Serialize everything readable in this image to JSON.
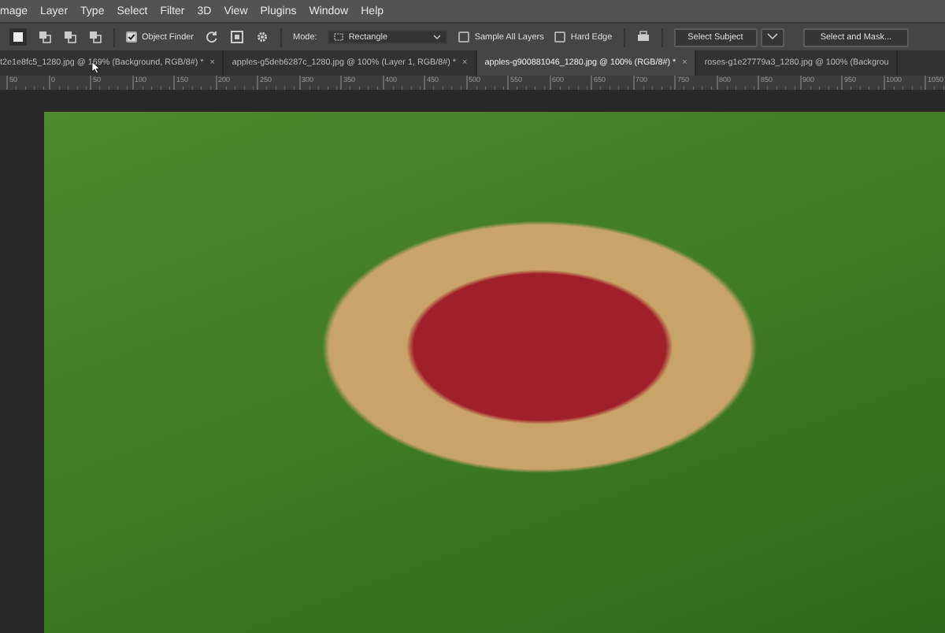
{
  "menu": [
    "mage",
    "Layer",
    "Type",
    "Select",
    "Filter",
    "3D",
    "View",
    "Plugins",
    "Window",
    "Help"
  ],
  "options": {
    "object_finder": {
      "label": "Object Finder",
      "checked": true
    },
    "mode_label": "Mode:",
    "mode_value": "Rectangle",
    "sample_all_layers": {
      "label": "Sample All Layers",
      "checked": false
    },
    "hard_edge": {
      "label": "Hard Edge",
      "checked": false
    },
    "select_subject": "Select Subject",
    "select_and_mask": "Select and Mask..."
  },
  "tabs": [
    {
      "label": "t2e1e8fc5_1280.jpg @ 169% (Background, RGB/8#) *",
      "close": "×",
      "selected": false
    },
    {
      "label": "apples-g5deb6287c_1280.jpg @ 100% (Layer 1, RGB/8#) *",
      "close": "×",
      "selected": false
    },
    {
      "label": "apples-g900881046_1280.jpg @ 100% (RGB/8#) *",
      "close": "×",
      "selected": true
    },
    {
      "label": "roses-g1e27779a3_1280.jpg @ 100% (Backgrou",
      "selected": false
    }
  ],
  "ruler": [
    "50",
    "0",
    "50",
    "100",
    "150",
    "200",
    "250",
    "300",
    "350",
    "400",
    "450",
    "500",
    "550",
    "600",
    "650",
    "700",
    "750",
    "800",
    "850",
    "900",
    "950",
    "1000",
    "1050"
  ]
}
